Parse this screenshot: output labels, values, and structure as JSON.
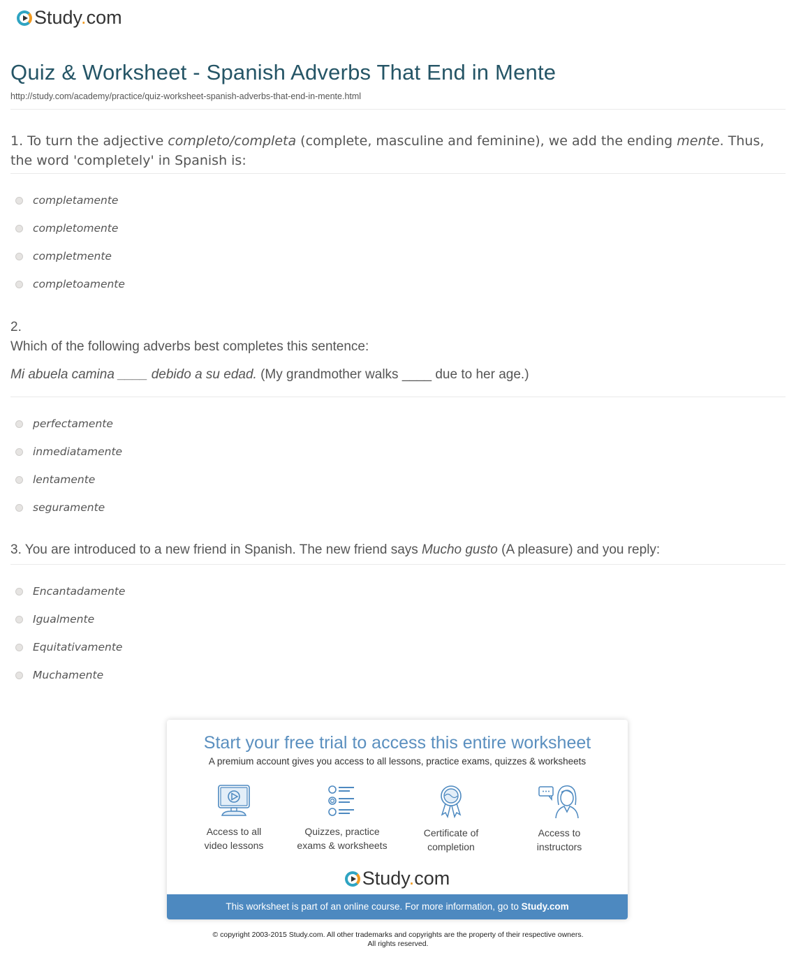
{
  "brand": {
    "name_main": "Study",
    "name_dot": ".",
    "name_tld": "com",
    "accent_color": "#f29b21",
    "ring_color": "#2fa4c2"
  },
  "header": {
    "title": "Quiz & Worksheet - Spanish Adverbs That End in Mente",
    "url": "http://study.com/academy/practice/quiz-worksheet-spanish-adverbs-that-end-in-mente.html"
  },
  "questions": [
    {
      "number": "1.",
      "text_parts": {
        "a": " To turn the adjective ",
        "b_italic": "completo/completa",
        "c": " (complete, masculine and feminine), we add the ending ",
        "d_italic": "mente",
        "e": ". Thus, the word 'completely' in Spanish is:"
      },
      "options": [
        "completamente",
        "completomente",
        "completmente",
        "completoamente"
      ]
    },
    {
      "number": "2.",
      "prompt": "Which of the following adverbs best completes this sentence:",
      "sentence_italic": "Mi abuela camina ____ debido a su edad.",
      "sentence_translation": " (My grandmother walks ____ due to her age.)",
      "options": [
        "perfectamente",
        "inmediatamente",
        "lentamente",
        "seguramente"
      ]
    },
    {
      "number": "3.",
      "text_parts": {
        "a": " You are introduced to a new friend in Spanish. The new friend says ",
        "b_italic": "Mucho gusto",
        "c": " (A pleasure) and you reply:"
      },
      "options": [
        "Encantadamente",
        "Igualmente",
        "Equitativamente",
        "Muchamente"
      ]
    }
  ],
  "promo": {
    "title": "Start your free trial to access this entire worksheet",
    "subtitle": "A premium account gives you access to all lessons, practice exams, quizzes & worksheets",
    "features": [
      {
        "icon": "video-lesson-icon",
        "line1": "Access to all",
        "line2": "video lessons"
      },
      {
        "icon": "quiz-list-icon",
        "line1": "Quizzes, practice",
        "line2": "exams & worksheets"
      },
      {
        "icon": "certificate-icon",
        "line1": "Certificate of",
        "line2": "completion"
      },
      {
        "icon": "instructor-icon",
        "line1": "Access to",
        "line2": "instructors"
      }
    ],
    "bar_text": "This worksheet is part of an online course. For more information, go to ",
    "bar_link": "Study.com",
    "title_color": "#5a8fbf",
    "bar_color": "#4d89c0"
  },
  "footer": {
    "line1": "© copyright 2003-2015 Study.com. All other trademarks and copyrights are the property of their respective owners.",
    "line2": "All rights reserved."
  }
}
